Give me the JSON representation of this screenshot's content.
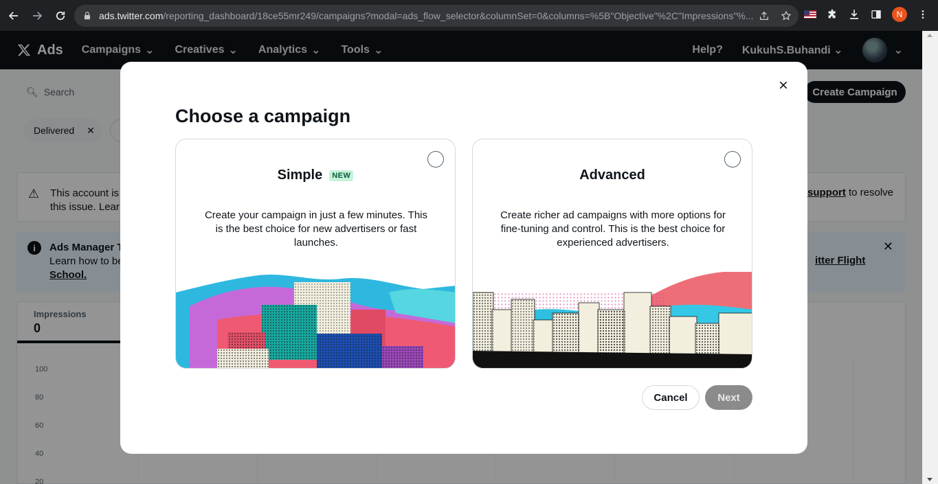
{
  "browser": {
    "url_host": "ads.twitter.com",
    "url_path": "/reporting_dashboard/18ce55mr249/campaigns?modal=ads_flow_selector&columnSet=0&columns=%5B\"Objective\"%2C\"Impressions\"%...",
    "profile_initial": "N"
  },
  "adsnav": {
    "brand": "Ads",
    "menu": [
      "Campaigns",
      "Creatives",
      "Analytics",
      "Tools"
    ],
    "help": "Help?",
    "username": "KukuhS.Buhandi"
  },
  "background": {
    "search_placeholder": "Search",
    "create_campaign": "Create Campaign",
    "filter_chip": "Delivered",
    "warning_text_line1": "This account is",
    "warning_text_line2": "this issue. Lear",
    "warning_link": "support",
    "warning_tail": " to resolve",
    "info_title": "Ads Manager T",
    "info_text": "Learn how to be",
    "info_link": "School.",
    "info_link_right": "itter Flight",
    "metric_label": "Impressions",
    "metric_value": "0",
    "y_ticks": [
      "100",
      "80",
      "60",
      "40",
      "20"
    ]
  },
  "modal": {
    "title": "Choose a campaign",
    "simple": {
      "title": "Simple",
      "badge": "NEW",
      "desc": "Create your campaign in just a few minutes. This is the best choice for new advertisers or fast launches."
    },
    "advanced": {
      "title": "Advanced",
      "desc": "Create richer ad campaigns with more options for fine-tuning and control. This is the best choice for experienced advertisers."
    },
    "cancel": "Cancel",
    "next": "Next"
  }
}
